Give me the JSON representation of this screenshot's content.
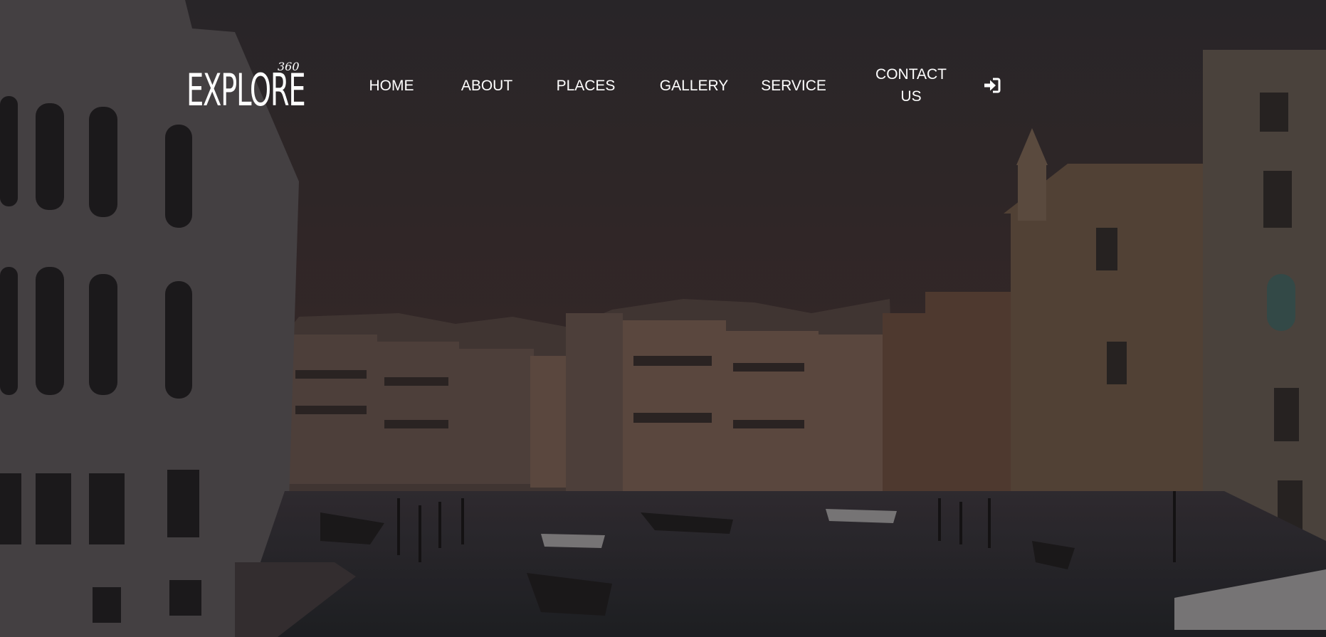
{
  "logo": {
    "text": "EXPLORE",
    "superscript": "360"
  },
  "nav": {
    "items": [
      {
        "label": "HOME"
      },
      {
        "label": "ABOUT"
      },
      {
        "label": "PLACES"
      },
      {
        "label": "GALLERY"
      },
      {
        "label": "SERVICE"
      },
      {
        "label": "CONTACT US"
      }
    ],
    "signin_icon": "sign-in-icon"
  },
  "hero": {
    "background": "venice-grand-canal-photo",
    "overlay_color": "#2a2324"
  }
}
